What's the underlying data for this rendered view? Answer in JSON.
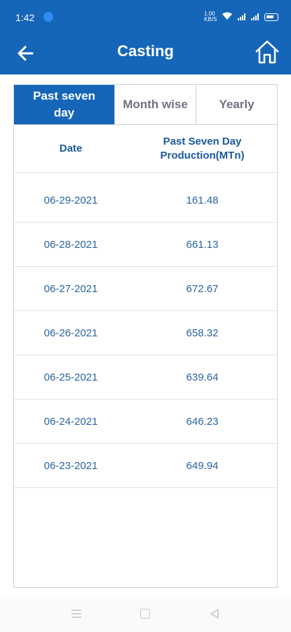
{
  "status_bar": {
    "time": "1:42",
    "data_speed": "1.00 KB/S",
    "battery": "50"
  },
  "app_bar": {
    "title": "Casting",
    "back_icon": "arrow-left-icon",
    "home_icon": "home-icon"
  },
  "tabs": [
    {
      "label": "Past seven day",
      "active": true
    },
    {
      "label": "Month wise",
      "active": false
    },
    {
      "label": "Yearly",
      "active": false
    }
  ],
  "table": {
    "headers": [
      "Date",
      "Past Seven Day Production(MTn)"
    ],
    "rows": [
      {
        "date": "06-29-2021",
        "value": "161.48"
      },
      {
        "date": "06-28-2021",
        "value": "661.13"
      },
      {
        "date": "06-27-2021",
        "value": "672.67"
      },
      {
        "date": "06-26-2021",
        "value": "658.32"
      },
      {
        "date": "06-25-2021",
        "value": "639.64"
      },
      {
        "date": "06-24-2021",
        "value": "646.23"
      },
      {
        "date": "06-23-2021",
        "value": "649.94"
      }
    ]
  },
  "colors": {
    "primary": "#1565b8",
    "text_blue": "#2a64a0",
    "inactive_tab_text": "#6f7280",
    "border": "#c9d3df"
  },
  "nav_bar": {
    "menu_icon": "menu-icon",
    "home_icon": "square-home-icon",
    "back_icon": "triangle-back-icon"
  }
}
